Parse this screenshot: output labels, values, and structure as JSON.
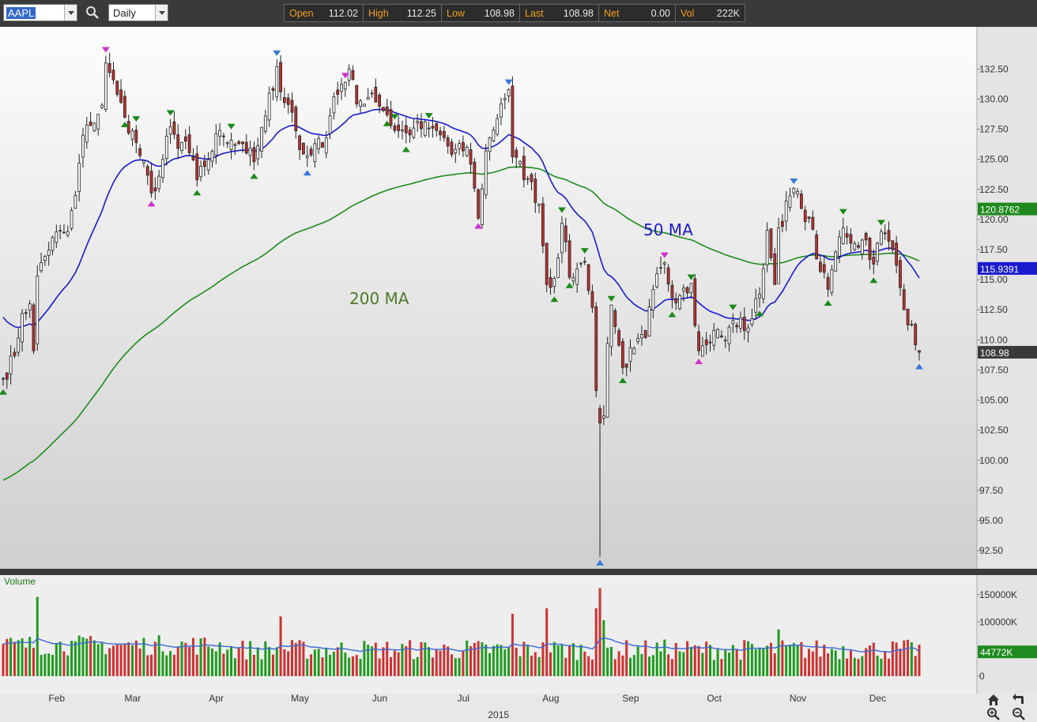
{
  "toolbar": {
    "symbol": "AAPL",
    "period": "Daily",
    "quote": [
      {
        "label": "Open",
        "value": "112.02"
      },
      {
        "label": "High",
        "value": "112.25"
      },
      {
        "label": "Low",
        "value": "108.98"
      },
      {
        "label": "Last",
        "value": "108.98"
      },
      {
        "label": "Net",
        "value": "0.00"
      },
      {
        "label": "Vol",
        "value": "222K"
      }
    ]
  },
  "colors": {
    "up_candle": "#ffffff",
    "down_candle": "#c0302c",
    "ma50": "#1a1ad0",
    "ma200": "#1f8a1f",
    "vol_up": "#1f9a1f",
    "vol_down": "#d03030",
    "marker_green": "#1a8a1a",
    "marker_blue": "#3a78d8",
    "marker_magenta": "#d030d0"
  },
  "annotations": {
    "ma50_label": "50 MA",
    "ma200_label": "200 MA"
  },
  "price_axis": {
    "ticks": [
      "132.50",
      "130.00",
      "127.50",
      "125.00",
      "122.50",
      "120.00",
      "117.50",
      "115.00",
      "112.50",
      "110.00",
      "107.50",
      "105.00",
      "102.50",
      "100.00",
      "97.50",
      "95.00",
      "92.50"
    ],
    "ma200_value": "120.8762",
    "ma50_value": "115.9391",
    "last_value": "108.98"
  },
  "volume_pane": {
    "title": "Volume",
    "ticks": [
      "150000K",
      "100000K",
      "0"
    ],
    "ma_value": "44772K"
  },
  "time_axis": {
    "months": [
      "Feb",
      "Mar",
      "Apr",
      "May",
      "Jun",
      "Jul",
      "Aug",
      "Sep",
      "Oct",
      "Nov",
      "Dec"
    ],
    "year": "2015"
  },
  "chart_data": {
    "type": "candlestick",
    "symbol": "AAPL",
    "period": "Daily",
    "ylim": [
      91,
      136
    ],
    "y_ticks": [
      92.5,
      95,
      97.5,
      100,
      102.5,
      105,
      107.5,
      110,
      112.5,
      115,
      117.5,
      120,
      122.5,
      125,
      127.5,
      130,
      132.5
    ],
    "x_months": [
      "Feb",
      "Mar",
      "Apr",
      "May",
      "Jun",
      "Jul",
      "Aug",
      "Sep",
      "Oct",
      "Nov",
      "Dec"
    ],
    "x_year": "2015",
    "anchors": [
      {
        "d": "2015-01-15",
        "close": 106.8
      },
      {
        "d": "2015-01-20",
        "close": 108.7
      },
      {
        "d": "2015-01-22",
        "close": 112.2
      },
      {
        "d": "2015-01-26",
        "close": 113.0
      },
      {
        "d": "2015-01-27",
        "close": 109.1
      },
      {
        "d": "2015-01-28",
        "close": 115.3
      },
      {
        "d": "2015-02-03",
        "close": 118.5
      },
      {
        "d": "2015-02-09",
        "close": 119.0
      },
      {
        "d": "2015-02-11",
        "close": 122.0
      },
      {
        "d": "2015-02-13",
        "close": 127.0
      },
      {
        "d": "2015-02-17",
        "close": 127.8
      },
      {
        "d": "2015-02-20",
        "close": 129.5
      },
      {
        "d": "2015-02-23",
        "close": 133.0
      },
      {
        "d": "2015-02-24",
        "close": 132.2
      },
      {
        "d": "2015-02-26",
        "close": 130.4
      },
      {
        "d": "2015-03-02",
        "close": 128.5
      },
      {
        "d": "2015-03-05",
        "close": 126.4
      },
      {
        "d": "2015-03-11",
        "close": 122.2
      },
      {
        "d": "2015-03-13",
        "close": 123.6
      },
      {
        "d": "2015-03-18",
        "close": 127.7
      },
      {
        "d": "2015-03-20",
        "close": 125.9
      },
      {
        "d": "2015-03-24",
        "close": 126.5
      },
      {
        "d": "2015-03-27",
        "close": 123.3
      },
      {
        "d": "2015-03-31",
        "close": 124.4
      },
      {
        "d": "2015-04-06",
        "close": 127.4
      },
      {
        "d": "2015-04-09",
        "close": 126.6
      },
      {
        "d": "2015-04-14",
        "close": 126.3
      },
      {
        "d": "2015-04-17",
        "close": 124.8
      },
      {
        "d": "2015-04-22",
        "close": 128.6
      },
      {
        "d": "2015-04-27",
        "close": 132.7
      },
      {
        "d": "2015-04-28",
        "close": 130.6
      },
      {
        "d": "2015-05-01",
        "close": 128.9
      },
      {
        "d": "2015-05-05",
        "close": 125.8
      },
      {
        "d": "2015-05-07",
        "close": 125.3
      },
      {
        "d": "2015-05-11",
        "close": 126.3
      },
      {
        "d": "2015-05-13",
        "close": 126.0
      },
      {
        "d": "2015-05-18",
        "close": 130.2
      },
      {
        "d": "2015-05-21",
        "close": 131.4
      },
      {
        "d": "2015-05-22",
        "close": 132.5
      },
      {
        "d": "2015-05-26",
        "close": 129.6
      },
      {
        "d": "2015-06-01",
        "close": 130.5
      },
      {
        "d": "2015-06-05",
        "close": 128.7
      },
      {
        "d": "2015-06-09",
        "close": 127.4
      },
      {
        "d": "2015-06-12",
        "close": 127.2
      },
      {
        "d": "2015-06-16",
        "close": 127.6
      },
      {
        "d": "2015-06-22",
        "close": 127.6
      },
      {
        "d": "2015-06-26",
        "close": 126.8
      },
      {
        "d": "2015-06-30",
        "close": 125.4
      },
      {
        "d": "2015-07-06",
        "close": 126.0
      },
      {
        "d": "2015-07-08",
        "close": 122.6
      },
      {
        "d": "2015-07-09",
        "close": 120.1
      },
      {
        "d": "2015-07-13",
        "close": 125.7
      },
      {
        "d": "2015-07-17",
        "close": 129.6
      },
      {
        "d": "2015-07-21",
        "close": 130.8
      },
      {
        "d": "2015-07-22",
        "close": 125.2
      },
      {
        "d": "2015-07-28",
        "close": 123.4
      },
      {
        "d": "2015-07-31",
        "close": 121.3
      },
      {
        "d": "2015-08-04",
        "close": 114.6
      },
      {
        "d": "2015-08-06",
        "close": 115.1
      },
      {
        "d": "2015-08-10",
        "close": 119.7
      },
      {
        "d": "2015-08-12",
        "close": 115.2
      },
      {
        "d": "2015-08-14",
        "close": 115.9
      },
      {
        "d": "2015-08-18",
        "close": 116.5
      },
      {
        "d": "2015-08-20",
        "close": 112.7
      },
      {
        "d": "2015-08-21",
        "close": 105.8
      },
      {
        "d": "2015-08-24",
        "close": 103.1
      },
      {
        "d": "2015-08-25",
        "close": 103.7
      },
      {
        "d": "2015-08-26",
        "close": 109.7
      },
      {
        "d": "2015-08-27",
        "close": 112.9
      },
      {
        "d": "2015-09-01",
        "close": 107.7
      },
      {
        "d": "2015-09-04",
        "close": 109.3
      },
      {
        "d": "2015-09-09",
        "close": 110.2
      },
      {
        "d": "2015-09-11",
        "close": 114.2
      },
      {
        "d": "2015-09-16",
        "close": 116.4
      },
      {
        "d": "2015-09-18",
        "close": 113.5
      },
      {
        "d": "2015-09-23",
        "close": 114.3
      },
      {
        "d": "2015-09-25",
        "close": 114.7
      },
      {
        "d": "2015-09-29",
        "close": 109.1
      },
      {
        "d": "2015-10-01",
        "close": 109.6
      },
      {
        "d": "2015-10-05",
        "close": 110.8
      },
      {
        "d": "2015-10-08",
        "close": 110.0
      },
      {
        "d": "2015-10-12",
        "close": 111.6
      },
      {
        "d": "2015-10-16",
        "close": 111.0
      },
      {
        "d": "2015-10-21",
        "close": 113.8
      },
      {
        "d": "2015-10-23",
        "close": 119.1
      },
      {
        "d": "2015-10-27",
        "close": 114.6
      },
      {
        "d": "2015-10-28",
        "close": 119.3
      },
      {
        "d": "2015-11-03",
        "close": 122.6
      },
      {
        "d": "2015-11-05",
        "close": 120.9
      },
      {
        "d": "2015-11-09",
        "close": 120.1
      },
      {
        "d": "2015-11-12",
        "close": 115.7
      },
      {
        "d": "2015-11-16",
        "close": 114.2
      },
      {
        "d": "2015-11-18",
        "close": 117.3
      },
      {
        "d": "2015-11-20",
        "close": 119.3
      },
      {
        "d": "2015-11-25",
        "close": 118.0
      },
      {
        "d": "2015-11-30",
        "close": 118.3
      },
      {
        "d": "2015-12-02",
        "close": 116.3
      },
      {
        "d": "2015-12-04",
        "close": 119.0
      },
      {
        "d": "2015-12-08",
        "close": 118.2
      },
      {
        "d": "2015-12-10",
        "close": 116.2
      },
      {
        "d": "2015-12-14",
        "close": 112.5
      },
      {
        "d": "2015-12-16",
        "close": 111.3
      },
      {
        "d": "2015-12-18",
        "close": 108.98
      }
    ],
    "ma50_start": 112.3,
    "ma200_start": 98.2,
    "markers": [
      {
        "d": "2015-01-15",
        "type": "low",
        "color": "green"
      },
      {
        "d": "2015-02-23",
        "type": "high",
        "color": "magenta"
      },
      {
        "d": "2015-03-02",
        "type": "low",
        "color": "green"
      },
      {
        "d": "2015-03-05",
        "type": "high",
        "color": "green"
      },
      {
        "d": "2015-03-11",
        "type": "low",
        "color": "magenta"
      },
      {
        "d": "2015-03-18",
        "type": "high",
        "color": "green"
      },
      {
        "d": "2015-03-27",
        "type": "low",
        "color": "green"
      },
      {
        "d": "2015-04-09",
        "type": "high",
        "color": "green"
      },
      {
        "d": "2015-04-17",
        "type": "low",
        "color": "green"
      },
      {
        "d": "2015-04-27",
        "type": "high",
        "color": "blue"
      },
      {
        "d": "2015-05-07",
        "type": "low",
        "color": "blue"
      },
      {
        "d": "2015-05-21",
        "type": "high",
        "color": "magenta"
      },
      {
        "d": "2015-06-05",
        "type": "low",
        "color": "green"
      },
      {
        "d": "2015-06-09",
        "type": "high",
        "color": "green"
      },
      {
        "d": "2015-06-12",
        "type": "low",
        "color": "green"
      },
      {
        "d": "2015-06-22",
        "type": "high",
        "color": "green"
      },
      {
        "d": "2015-07-09",
        "type": "low",
        "color": "magenta"
      },
      {
        "d": "2015-07-21",
        "type": "high",
        "color": "blue"
      },
      {
        "d": "2015-08-06",
        "type": "low",
        "color": "green"
      },
      {
        "d": "2015-08-10",
        "type": "high",
        "color": "green"
      },
      {
        "d": "2015-08-12",
        "type": "low",
        "color": "green"
      },
      {
        "d": "2015-08-18",
        "type": "high",
        "color": "green"
      },
      {
        "d": "2015-08-24",
        "type": "low",
        "color": "blue"
      },
      {
        "d": "2015-08-27",
        "type": "high",
        "color": "green"
      },
      {
        "d": "2015-09-01",
        "type": "low",
        "color": "green"
      },
      {
        "d": "2015-09-16",
        "type": "high",
        "color": "magenta"
      },
      {
        "d": "2015-09-18",
        "type": "low",
        "color": "green"
      },
      {
        "d": "2015-09-25",
        "type": "high",
        "color": "green"
      },
      {
        "d": "2015-09-29",
        "type": "low",
        "color": "magenta"
      },
      {
        "d": "2015-10-12",
        "type": "high",
        "color": "green"
      },
      {
        "d": "2015-10-21",
        "type": "low",
        "color": "green"
      },
      {
        "d": "2015-11-03",
        "type": "high",
        "color": "blue"
      },
      {
        "d": "2015-11-16",
        "type": "low",
        "color": "green"
      },
      {
        "d": "2015-11-20",
        "type": "high",
        "color": "green"
      },
      {
        "d": "2015-12-02",
        "type": "low",
        "color": "green"
      },
      {
        "d": "2015-12-04",
        "type": "high",
        "color": "green"
      },
      {
        "d": "2015-12-18",
        "type": "low",
        "color": "blue"
      }
    ],
    "series": [
      {
        "name": "50 MA",
        "color": "#1a1ad0",
        "last": 115.9391
      },
      {
        "name": "200 MA",
        "color": "#1f8a1f",
        "last": 120.8762
      }
    ],
    "volume": {
      "ylim_k": [
        0,
        160000
      ],
      "y_ticks_k": [
        0,
        100000,
        150000
      ],
      "ma_last_k": 44772,
      "spikes": [
        {
          "d": "2015-01-28",
          "k": 146000
        },
        {
          "d": "2015-02-10",
          "k": 65000
        },
        {
          "d": "2015-04-28",
          "k": 110000
        },
        {
          "d": "2015-07-22",
          "k": 115000
        },
        {
          "d": "2015-08-04",
          "k": 125000
        },
        {
          "d": "2015-08-21",
          "k": 125000
        },
        {
          "d": "2015-08-24",
          "k": 162000
        },
        {
          "d": "2015-08-25",
          "k": 103000
        },
        {
          "d": "2015-10-28",
          "k": 86000
        }
      ]
    }
  }
}
